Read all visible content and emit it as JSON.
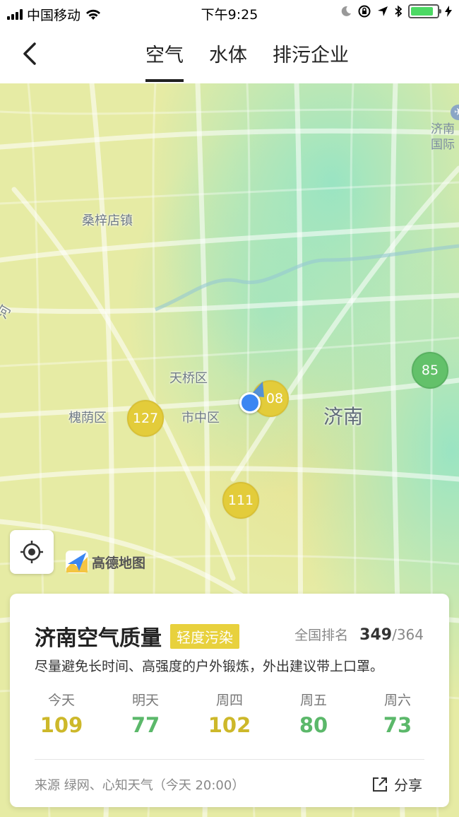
{
  "status_bar": {
    "carrier": "中国移动",
    "time": "下午9:25",
    "battery_level": 0.85
  },
  "nav": {
    "tabs": [
      {
        "label": "空气",
        "active": true
      },
      {
        "label": "水体",
        "active": false
      },
      {
        "label": "排污企业",
        "active": false
      }
    ]
  },
  "map": {
    "labels": {
      "sangzidian": "桑梓店镇",
      "tianqiao": "天桥区",
      "huaiyin": "槐荫区",
      "shizhong": "市中区",
      "jinan": "济南",
      "airport": "济南\n国际",
      "river_fragment": "河"
    },
    "markers": [
      {
        "value": "127",
        "level": "yellow"
      },
      {
        "value": "08",
        "level": "yellow"
      },
      {
        "value": "111",
        "level": "yellow"
      },
      {
        "value": "85",
        "level": "green"
      }
    ],
    "provider": "高德地图"
  },
  "card": {
    "title": "济南空气质量",
    "badge": "轻度污染",
    "rank_label": "全国排名",
    "rank_value": "349",
    "rank_total": "/364",
    "advice": "尽量避免长时间、高强度的户外锻炼，外出建议带上口罩。",
    "forecast": [
      {
        "label": "今天",
        "value": "109",
        "color": "#cdb82a"
      },
      {
        "label": "明天",
        "value": "77",
        "color": "#5bb86a"
      },
      {
        "label": "周四",
        "value": "102",
        "color": "#cdb82a"
      },
      {
        "label": "周五",
        "value": "80",
        "color": "#5bb86a"
      },
      {
        "label": "周六",
        "value": "73",
        "color": "#5bb86a"
      }
    ],
    "source": "来源 绿网、心知天气（今天 20:00）",
    "share_label": "分享"
  },
  "colors": {
    "yellow_marker": "#e3cc3a",
    "green_marker": "#63c16a",
    "badge": "#e8d13d"
  }
}
